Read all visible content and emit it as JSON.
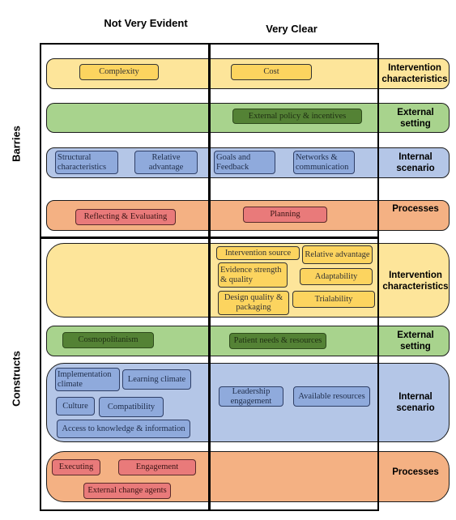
{
  "columns": {
    "not_very_evident": "Not Very Evident",
    "very_clear": "Very Clear"
  },
  "sections": {
    "barriers": "Barries",
    "constructs": "Constructs"
  },
  "barriers": {
    "intervention": {
      "label": "Intervention characteristics",
      "not_evident": [
        "Complexity"
      ],
      "very_clear": [
        "Cost"
      ]
    },
    "external": {
      "label": "External setting",
      "not_evident": [],
      "very_clear": [
        "External policy & incentives"
      ]
    },
    "internal": {
      "label": "Internal scenario",
      "not_evident": [
        "Structural characteristics",
        "Relative advantage"
      ],
      "very_clear": [
        "Goals and Feedback",
        "Networks & communication"
      ]
    },
    "processes": {
      "label": "Processes",
      "not_evident": [
        "Reflecting & Evaluating"
      ],
      "very_clear": [
        "Planning"
      ]
    }
  },
  "constructs": {
    "intervention": {
      "label": "Intervention characteristics",
      "not_evident": [],
      "very_clear": [
        "Intervention source",
        "Relative advantage",
        "Evidence strength & quality",
        "Adaptability",
        "Design quality & packaging",
        "Trialability"
      ]
    },
    "external": {
      "label": "External setting",
      "not_evident": [
        "Cosmopolitanism"
      ],
      "very_clear": [
        "Patient needs & resources"
      ]
    },
    "internal": {
      "label": "Internal scenario",
      "not_evident": [
        "Implementation climate",
        "Learning climate",
        "Culture",
        "Compatibility",
        "Access to knowledge & information"
      ],
      "very_clear": [
        "Leadership engagement",
        "Available resources"
      ]
    },
    "processes": {
      "label": "Processes",
      "not_evident": [
        "Executing",
        "Engagement",
        "External change agents"
      ],
      "very_clear": []
    }
  },
  "colors": {
    "intervention": "#fde59a",
    "external": "#a8d38d",
    "internal": "#b4c6e7",
    "processes": "#f4b183"
  }
}
